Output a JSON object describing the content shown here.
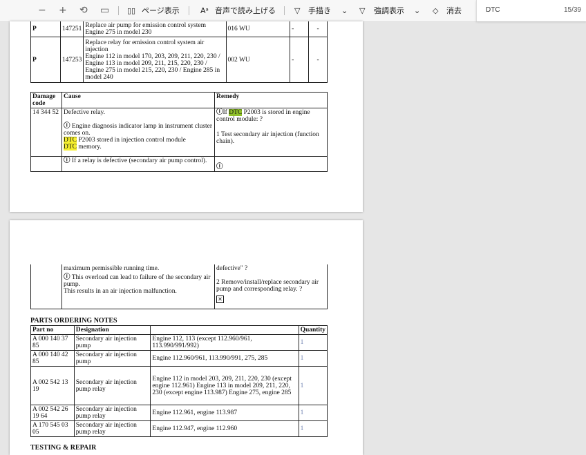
{
  "toolbar": {
    "minus": "−",
    "plus": "+",
    "fit": "⟲",
    "spread": "▭",
    "page_view": "ページ表示",
    "read_aloud": "音声で読み上げる",
    "draw": "手描き",
    "highlight": "強調表示",
    "erase": "消去"
  },
  "search": {
    "query": "DTC",
    "count": "15/39"
  },
  "page1": {
    "parts_rows": [
      {
        "c1": "P",
        "c2": "147251",
        "c3a": "Replace air pump for emission control system",
        "c3b": "Engine 275 in model 230",
        "c4": "016 WU",
        "c5": "-",
        "c6": "-"
      },
      {
        "c1": "P",
        "c2": "147253",
        "c3a": "Replace relay for emission control system air injection",
        "c3b": "Engine 112 in model 170, 203, 209, 211, 220, 230 / Engine 113 in model 209, 211, 215, 220, 230 / Engine 275 in model 215, 220, 230 / Engine 285 in model 240",
        "c4": "002 WU",
        "c5": "-",
        "c6": "-"
      }
    ],
    "damage": {
      "h_code": "Damage code",
      "h_cause": "Cause",
      "h_remedy": "Remedy",
      "code": "14 344 52",
      "cause1": "Defective relay.",
      "cause2": "Engine diagnosis indicator lamp in instrument cluster comes on.",
      "cause3_dtc": "DTC",
      "cause3": " P2003 stored in injection control module",
      "cause4_dtc": "DTC",
      "cause4": " memory.",
      "cause5": "If a relay is defective (secondary air pump control).",
      "rem1a": "If ",
      "rem1_dtc": "DTC",
      "rem1b": " P2003 is stored in engine control module: ?",
      "rem2": "1 Test secondary air injection (function chain)."
    }
  },
  "page2": {
    "cont": {
      "c1": "maximum permissible running time.",
      "c2": "This overload can lead to failure of the secondary air pump.",
      "c3": "This results in an air injection malfunction.",
      "r1": "defective\" ?",
      "r2": "2 Remove/install/replace secondary air pump and corresponding relay. ?"
    },
    "notes_title": "PARTS ORDERING NOTES",
    "headers": {
      "part": "Part no",
      "desig": "Designation",
      "qty": "Quantity"
    },
    "rows": [
      {
        "part": "A 000 140 37 85",
        "desig": "Secondary air injection pump",
        "note": "Engine 112, 113 (except 112.960/961, 113.990/991/992)",
        "qty": "1"
      },
      {
        "part": "A 000 140 42 85",
        "desig": "Secondary air injection pump",
        "note": "Engine 112.960/961, 113.990/991, 275, 285",
        "qty": "1"
      },
      {
        "part": "A 002 542 13 19",
        "desig": "Secondary air injection pump relay",
        "note": "Engine 112 in model 203, 209, 211, 220, 230 (except engine 112.961) Engine 113 in model 209, 211, 220, 230 (except engine 113.987) Engine 275, engine 285",
        "qty": "1"
      },
      {
        "part": "A 002 542 26 19 64",
        "desig": "Secondary air injection pump relay",
        "note": "Engine 112.961, engine 113.987",
        "qty": "1"
      },
      {
        "part": "A 170 545 03 05",
        "desig": "Secondary air injection pump relay",
        "note": "Engine 112.947, engine 112.960",
        "qty": "1"
      }
    ],
    "next_title": "TESTING & REPAIR"
  },
  "colors": {
    "highlight": "#f5ef2f",
    "current_match": "#8fc02a",
    "qty": "#6b7fb0"
  }
}
